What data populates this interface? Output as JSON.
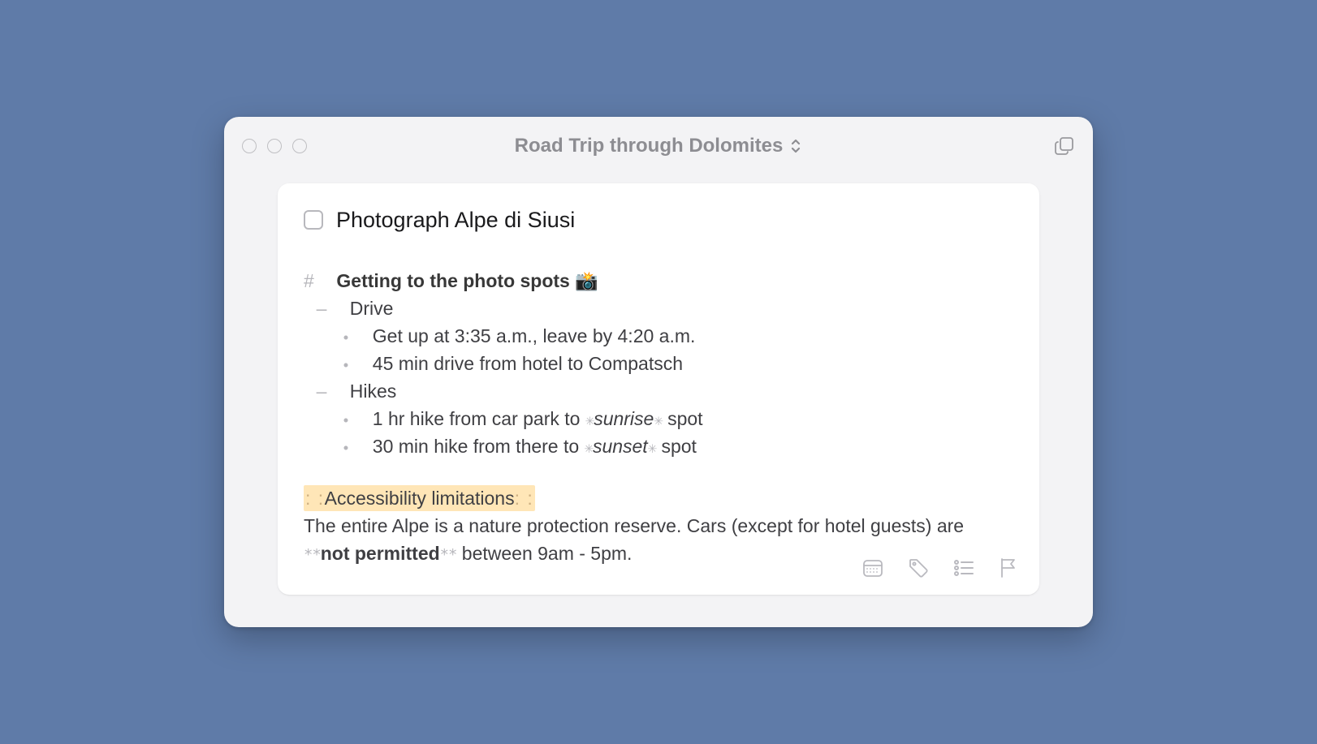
{
  "window": {
    "title": "Road Trip through Dolomites"
  },
  "task": {
    "title": "Photograph Alpe di Siusi",
    "checked": false
  },
  "note": {
    "heading_marker": "#",
    "heading_text": "Getting to the photo spots",
    "heading_emoji": "📸",
    "sections": [
      {
        "label": "Drive",
        "items": [
          "Get up at 3:35 a.m., leave by 4:20 a.m.",
          "45 min drive from hotel to Compatsch"
        ]
      },
      {
        "label": "Hikes",
        "items_rich": [
          {
            "pre": "1 hr hike from car park to ",
            "em": "sunrise",
            "post": " spot"
          },
          {
            "pre": "30 min hike from there to ",
            "em": "sunset",
            "post": " spot"
          }
        ]
      }
    ],
    "highlight_label": "Accessibility limitations",
    "body_pre": "The entire Alpe is a nature protection reserve. Cars (except for hotel guests) are ",
    "body_strong": "not permitted",
    "body_post": " between 9am - 5pm."
  },
  "markers": {
    "colons": ": :",
    "stars2": "**",
    "star1": "✳",
    "dash": "–",
    "bullet": "•"
  },
  "actions": {
    "calendar": "calendar-icon",
    "tag": "tag-icon",
    "checklist": "checklist-icon",
    "flag": "flag-icon"
  }
}
